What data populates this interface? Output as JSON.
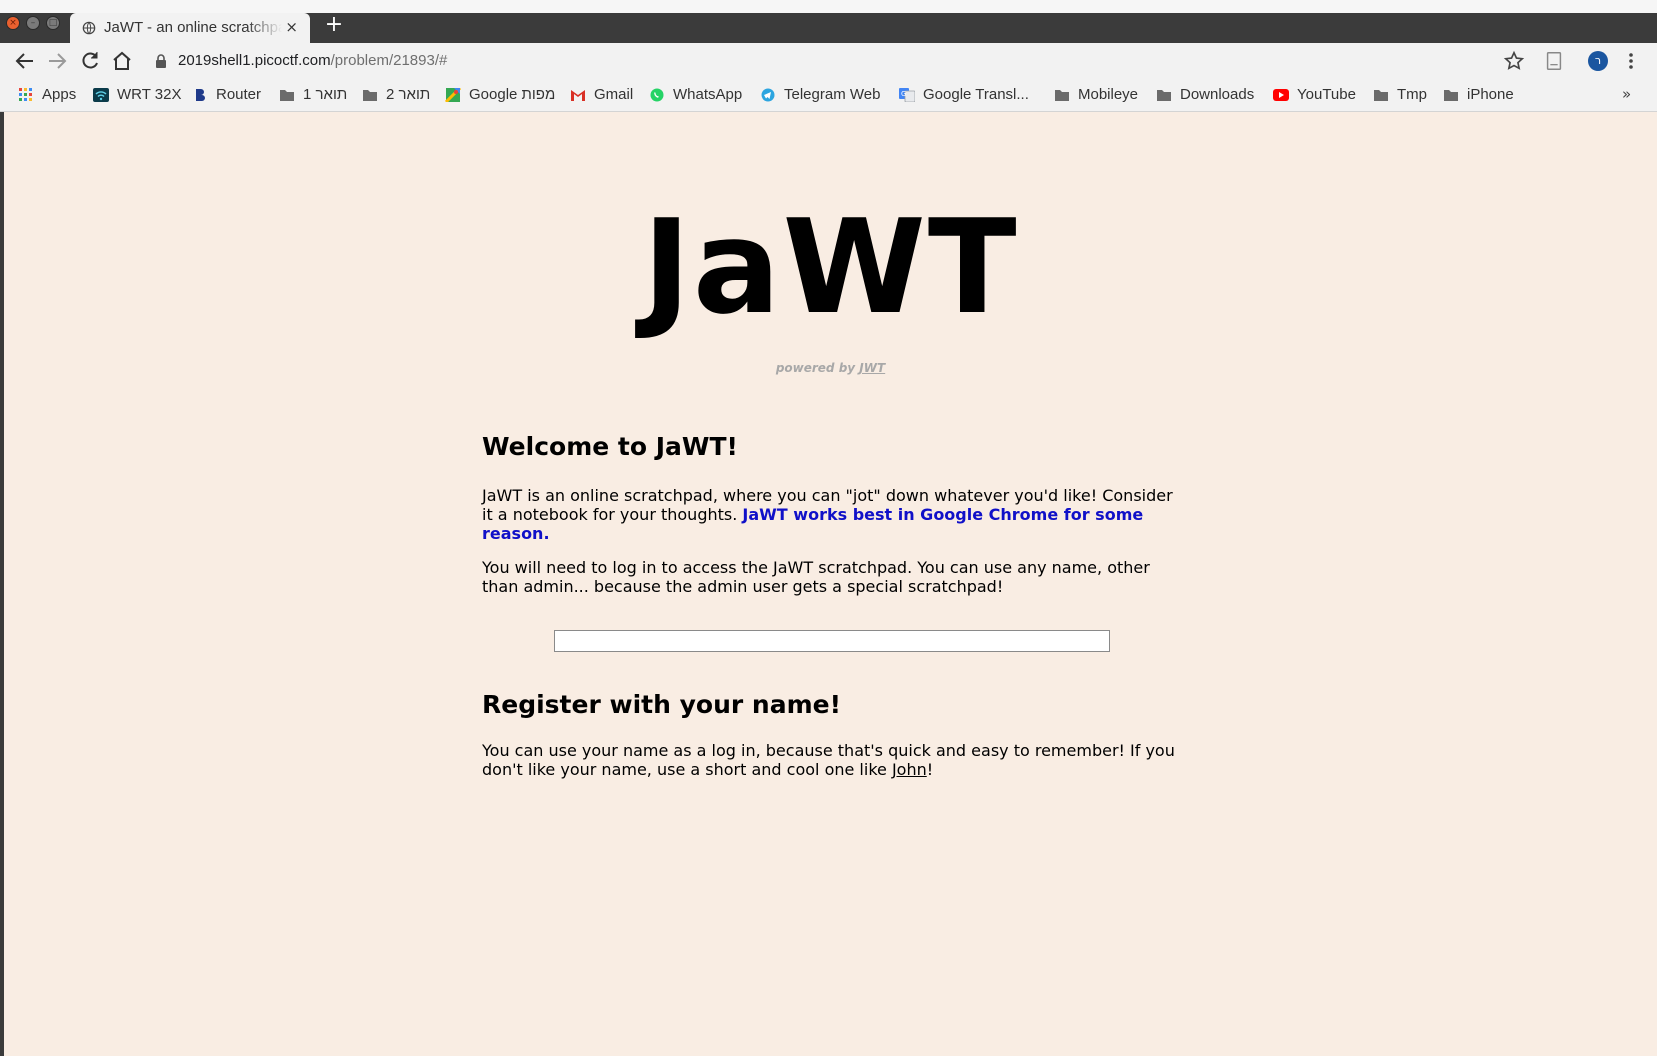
{
  "window": {
    "tab_title": "JaWT - an online scratchpad",
    "tab_close": "×",
    "new_tab": "+"
  },
  "toolbar": {
    "url_host": "2019shell1.picoctf.com",
    "url_path": "/problem/21893/#",
    "profile_initial": "ר"
  },
  "bookmarks": {
    "items": [
      {
        "label": "Apps",
        "icon": "apps-grid-icon"
      },
      {
        "label": "WRT 32X",
        "icon": "wifi-icon"
      },
      {
        "label": "Router",
        "icon": "router-icon"
      },
      {
        "label": "תואר 1",
        "icon": "folder-icon"
      },
      {
        "label": "תואר 2",
        "icon": "folder-icon"
      },
      {
        "label": "Google מפות",
        "icon": "maps-icon"
      },
      {
        "label": "Gmail",
        "icon": "gmail-icon"
      },
      {
        "label": "WhatsApp",
        "icon": "whatsapp-icon"
      },
      {
        "label": "Telegram Web",
        "icon": "telegram-icon"
      },
      {
        "label": "Google Transl...",
        "icon": "translate-icon"
      },
      {
        "label": "Mobileye",
        "icon": "folder-icon"
      },
      {
        "label": "Downloads",
        "icon": "folder-icon"
      },
      {
        "label": "YouTube",
        "icon": "youtube-icon"
      },
      {
        "label": "Tmp",
        "icon": "folder-icon"
      },
      {
        "label": "iPhone",
        "icon": "folder-icon"
      }
    ],
    "more": "»"
  },
  "page": {
    "logo": "JaWT",
    "powered_prefix": "powered by ",
    "powered_link": "JWT",
    "welcome_heading": "Welcome to JaWT!",
    "intro_text": " JaWT is an online scratchpad, where you can \"jot\" down whatever you'd like! Consider it a notebook for your thoughts. ",
    "intro_highlight": "JaWT works best in Google Chrome for some reason.",
    "login_text": " You will need to log in to access the JaWT scratchpad. You can use any name, other than admin... because the admin user gets a special scratchpad!",
    "login_input_value": "",
    "register_heading": "Register with your name!",
    "register_text_before": " You can use your name as a log in, because that's quick and easy to remember! If you don't like your name, use a short and cool one like ",
    "register_link": "John",
    "register_text_after": "!"
  },
  "colors": {
    "page_background": "#f9ede3",
    "highlight_blue": "#1010c8",
    "powered_gray": "#a8a8a8",
    "chrome_dark": "#3b3b3b"
  }
}
